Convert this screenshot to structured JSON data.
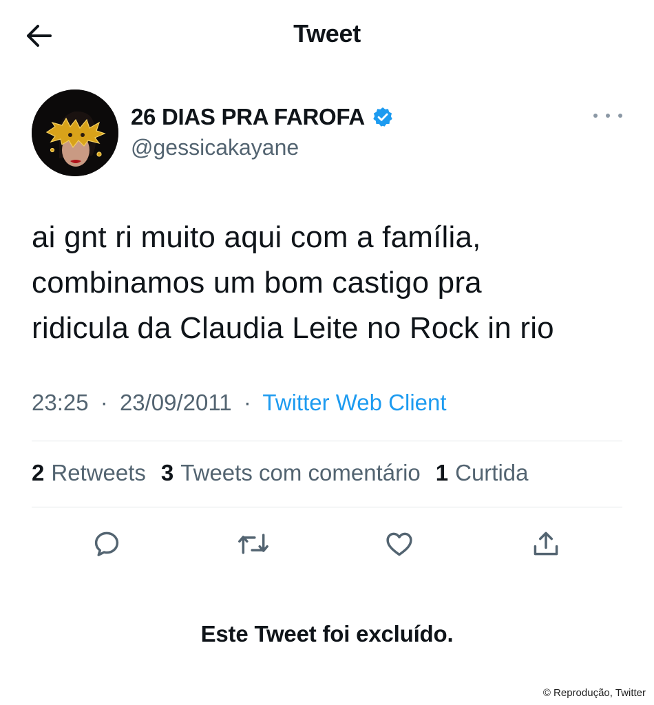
{
  "header": {
    "title": "Tweet",
    "back_icon": "arrow-left-icon"
  },
  "author": {
    "display_name": "26 DIAS PRA FAROFA",
    "handle": "@gessicakayane",
    "verified_icon": "verified-badge-icon",
    "verified_color": "#1d9bf0"
  },
  "tweet": {
    "lines": [
      "ai gnt ri muito aqui com a família,",
      "combinamos um bom castigo pra",
      "ridicula da Claudia Leite no Rock in rio"
    ],
    "time": "23:25",
    "date": "23/09/2011",
    "separator": "·",
    "source": "Twitter Web Client"
  },
  "stats": {
    "retweets_count": "2",
    "retweets_label": "Retweets",
    "quotes_count": "3",
    "quotes_label": "Tweets com comentário",
    "likes_count": "1",
    "likes_label": "Curtida"
  },
  "actions": [
    "reply-icon",
    "retweet-icon",
    "like-icon",
    "share-icon"
  ],
  "notice": "Este Tweet foi excluído.",
  "credit": "© Reprodução, Twitter",
  "colors": {
    "accent": "#1d9bf0",
    "text": "#0f1419",
    "secondary": "#536471",
    "divider": "#e3e6e8"
  }
}
